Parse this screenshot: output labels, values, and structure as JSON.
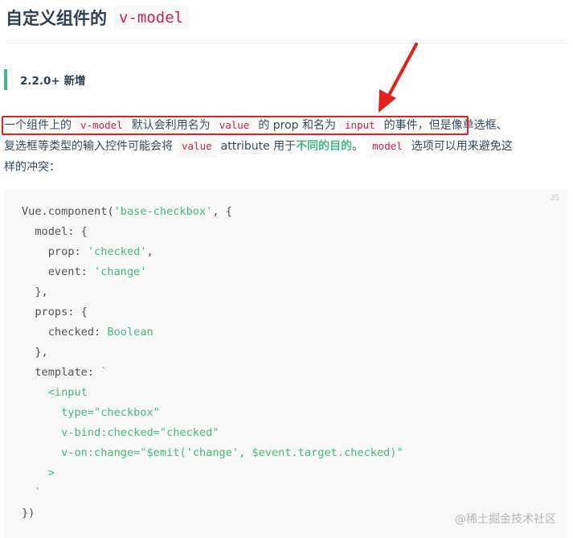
{
  "heading": {
    "text": "自定义组件的",
    "code": "v-model"
  },
  "tip": {
    "text": "2.2.0+ 新增"
  },
  "paragraph": {
    "line1": {
      "t1": "一个组件上的",
      "c1": "v-model",
      "t2": "默认会利用名为",
      "c2": "value",
      "t3": "的 prop 和名为",
      "c3": "input",
      "t4": "的事件，但是像单选框、"
    },
    "line2": {
      "t1": "复选框等类型的输入控件可能会将",
      "c1": "value",
      "t2": "attribute 用于",
      "strong": "不同的目的",
      "t3": "。",
      "c2": "model",
      "t4": "选项可以用来避免这"
    },
    "line3": {
      "t1": "样的冲突："
    }
  },
  "code_block": {
    "lang": "JS",
    "lines": [
      [
        {
          "t": "Vue.component(",
          "c": "p"
        },
        {
          "t": "'base-checkbox'",
          "c": "s"
        },
        {
          "t": ", {",
          "c": "p"
        }
      ],
      [
        {
          "t": "  model: {",
          "c": "p"
        }
      ],
      [
        {
          "t": "    prop: ",
          "c": "p"
        },
        {
          "t": "'checked'",
          "c": "s"
        },
        {
          "t": ",",
          "c": "p"
        }
      ],
      [
        {
          "t": "    event: ",
          "c": "p"
        },
        {
          "t": "'change'",
          "c": "s"
        }
      ],
      [
        {
          "t": "  },",
          "c": "p"
        }
      ],
      [
        {
          "t": "  props: {",
          "c": "p"
        }
      ],
      [
        {
          "t": "    checked: ",
          "c": "p"
        },
        {
          "t": "Boolean",
          "c": "s"
        }
      ],
      [
        {
          "t": "  },",
          "c": "p"
        }
      ],
      [
        {
          "t": "  template: ",
          "c": "p"
        },
        {
          "t": "`",
          "c": "s"
        }
      ],
      [
        {
          "t": "    <input",
          "c": "s"
        }
      ],
      [
        {
          "t": "      type=\"checkbox\"",
          "c": "s"
        }
      ],
      [
        {
          "t": "      v-bind:checked=\"checked\"",
          "c": "s"
        }
      ],
      [
        {
          "t": "      v-on:change=\"$emit('change', $event.target.checked)\"",
          "c": "s"
        }
      ],
      [
        {
          "t": "    >",
          "c": "s"
        }
      ],
      [
        {
          "t": "  `",
          "c": "s"
        }
      ],
      [
        {
          "t": "})",
          "c": "p"
        }
      ]
    ]
  },
  "watermark": "@稀土掘金技术社区",
  "colors": {
    "accent": "#42b983",
    "inline_code": "#c7254e",
    "annotation": "#e3211c"
  }
}
